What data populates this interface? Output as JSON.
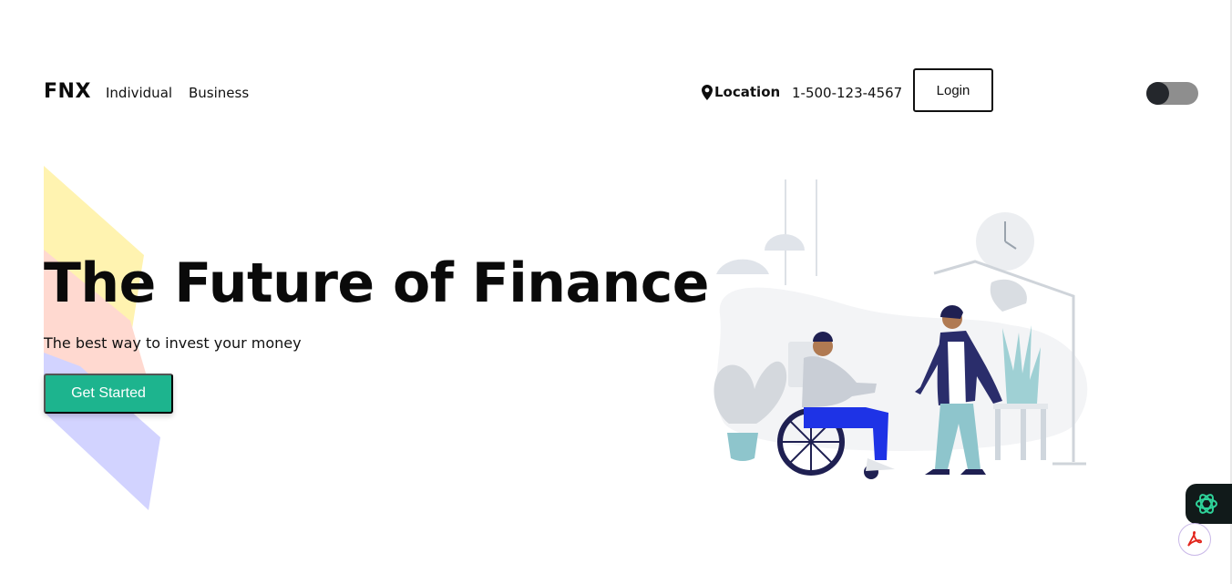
{
  "nav": {
    "brand": "FNX",
    "links": [
      "Individual",
      "Business"
    ],
    "location_label": "Location",
    "phone": "1-500-123-4567",
    "login_label": "Login"
  },
  "theme_toggle": {
    "state": "off"
  },
  "hero": {
    "title": "The Future of Finance",
    "subtitle": "The best way to invest your money",
    "cta_label": "Get Started"
  },
  "colors": {
    "accent": "#1db48e",
    "shape_yellow": "#fff3b0",
    "shape_pink": "#ffd9d0",
    "shape_blue": "#d2d3ff",
    "illustration_navy": "#2a2d6b",
    "illustration_teal": "#8ec5cc"
  },
  "icons": {
    "location": "map-pin-icon",
    "ai_extension": "openai-icon",
    "pdf_extension": "acrobat-icon"
  }
}
